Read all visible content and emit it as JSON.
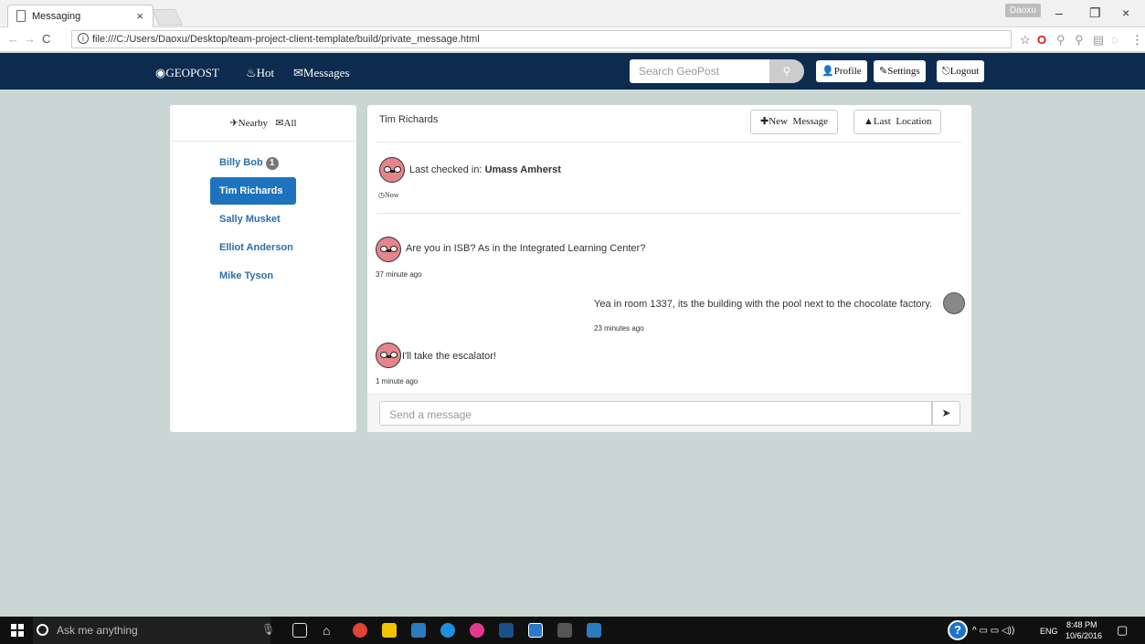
{
  "browser": {
    "tab_title": "Messaging",
    "tab_close": "×",
    "profile_chip": "Daoxu",
    "url": "file:///C:/Users/Daoxu/Desktop/team-project-client-template/build/private_message.html",
    "window_controls": {
      "minimize": "–",
      "restore": "❐",
      "close": "×"
    }
  },
  "navbar": {
    "brand": "GEOPOST",
    "hot": "Hot",
    "messages": "Messages",
    "search_placeholder": "Search GeoPost",
    "profile": "Profile",
    "settings": "Settings",
    "logout": "Logout",
    "bg_color": "#0d2b4e"
  },
  "left_panel": {
    "tab_nearby": "Nearby",
    "tab_all": "All",
    "contacts": [
      {
        "name": "Billy Bob",
        "badge": "1"
      },
      {
        "name": "Tim Richards",
        "active": true
      },
      {
        "name": "Sally Musket"
      },
      {
        "name": "Elliot Anderson"
      },
      {
        "name": "Mike Tyson"
      }
    ]
  },
  "chat": {
    "contact_name": "Tim Richards",
    "new_message_1": "New",
    "new_message_2": "Message",
    "last_location_1": "Last",
    "last_location_2": "Location",
    "checkin_prefix": "Last checked in: ",
    "checkin_place": "Umass Amherst",
    "checkin_time": "Now",
    "messages": [
      {
        "from": "Tim Richards",
        "text": "Are you in ISB? As in the Integrated Learning Center?",
        "time": "37 minute ago"
      },
      {
        "from": "me",
        "text": "Yea in room 1337, its the building with the pool next to the chocolate factory.",
        "time": "23 minutes ago"
      },
      {
        "from": "Tim Richards",
        "text": "I'll take the escalator!",
        "time": "1 minute ago"
      }
    ],
    "input_placeholder": "Send a message"
  },
  "taskbar": {
    "search_placeholder": "Ask me anything",
    "language": "ENG",
    "time": "8:48 PM",
    "date": "10/6/2016"
  }
}
